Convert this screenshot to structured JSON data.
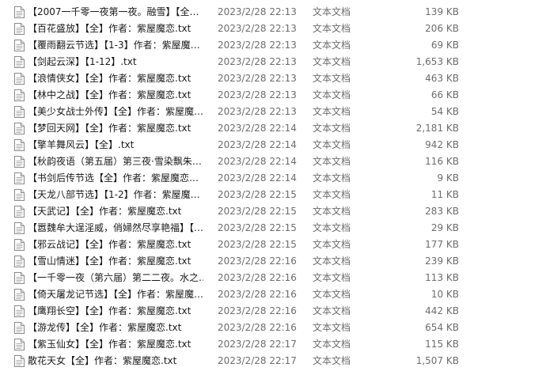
{
  "columns": {
    "icon": "text-document-icon"
  },
  "files": [
    {
      "name": "【2007一千零一夜第一夜。融雪】【全…",
      "date": "2023/2/28 22:13",
      "type": "文本文档",
      "size": "139 KB"
    },
    {
      "name": "【百花盛放】【全】作者：紫屋魔恋.txt",
      "date": "2023/2/28 22:13",
      "type": "文本文档",
      "size": "206 KB"
    },
    {
      "name": "【覆雨翻云节选】【1-3】作者：紫屋魔…",
      "date": "2023/2/28 22:13",
      "type": "文本文档",
      "size": "69 KB"
    },
    {
      "name": "【剑起云深】【1-12】.txt",
      "date": "2023/2/28 22:13",
      "type": "文本文档",
      "size": "1,653 KB"
    },
    {
      "name": "【浪情侠女】【全】作者：紫屋魔恋.txt",
      "date": "2023/2/28 22:13",
      "type": "文本文档",
      "size": "463 KB"
    },
    {
      "name": "【林中之战】【全】作者：紫屋魔恋.txt",
      "date": "2023/2/28 22:13",
      "type": "文本文档",
      "size": "66 KB"
    },
    {
      "name": "【美少女战士外传】【全】作者：紫屋魔…",
      "date": "2023/2/28 22:13",
      "type": "文本文档",
      "size": "54 KB"
    },
    {
      "name": "【梦回天网】【全】作者：紫屋魔恋.txt",
      "date": "2023/2/28 22:14",
      "type": "文本文档",
      "size": "2,181 KB"
    },
    {
      "name": "【擎羊舞风云】【全】.txt",
      "date": "2023/2/28 22:14",
      "type": "文本文档",
      "size": "942 KB"
    },
    {
      "name": "【秋韵夜语（第五届）第三夜·雪染飘朱…",
      "date": "2023/2/28 22:14",
      "type": "文本文档",
      "size": "116 KB"
    },
    {
      "name": "【书剑后传节选【全】作者：紫屋魔恋…",
      "date": "2023/2/28 22:14",
      "type": "文本文档",
      "size": "9 KB"
    },
    {
      "name": "【天龙八部节选】【1-2】作者：紫屋魔…",
      "date": "2023/2/28 22:15",
      "type": "文本文档",
      "size": "11 KB"
    },
    {
      "name": "【天武记】【全】作者：紫屋魔恋.txt",
      "date": "2023/2/28 22:15",
      "type": "文本文档",
      "size": "283 KB"
    },
    {
      "name": "【嚣魏牟大逞淫威，俏婦然尽享艳福】【…",
      "date": "2023/2/28 22:15",
      "type": "文本文档",
      "size": "29 KB"
    },
    {
      "name": "【邪云战记】【全】作者：紫屋魔恋.txt",
      "date": "2023/2/28 22:15",
      "type": "文本文档",
      "size": "177 KB"
    },
    {
      "name": "【雪山情迷】【全】作者：紫屋魔恋.txt",
      "date": "2023/2/28 22:16",
      "type": "文本文档",
      "size": "239 KB"
    },
    {
      "name": "【一千零一夜（第六届）第二二夜。水之…",
      "date": "2023/2/28 22:16",
      "type": "文本文档",
      "size": "113 KB"
    },
    {
      "name": "【倚天屠龙记节选】【全】作者：紫屋魔…",
      "date": "2023/2/28 22:16",
      "type": "文本文档",
      "size": "10 KB"
    },
    {
      "name": "【鹰翔长空】【全】作者：紫屋魔恋.txt",
      "date": "2023/2/28 22:16",
      "type": "文本文档",
      "size": "442 KB"
    },
    {
      "name": "【游龙传】【全】作者：紫屋魔恋.txt",
      "date": "2023/2/28 22:16",
      "type": "文本文档",
      "size": "654 KB"
    },
    {
      "name": "【紫玉仙女】【全】作者：紫屋魔恋.txt",
      "date": "2023/2/28 22:17",
      "type": "文本文档",
      "size": "115 KB"
    },
    {
      "name": "散花天女【全】作者：紫屋魔恋.txt",
      "date": "2023/2/28 22:17",
      "type": "文本文档",
      "size": "1,507 KB"
    }
  ]
}
